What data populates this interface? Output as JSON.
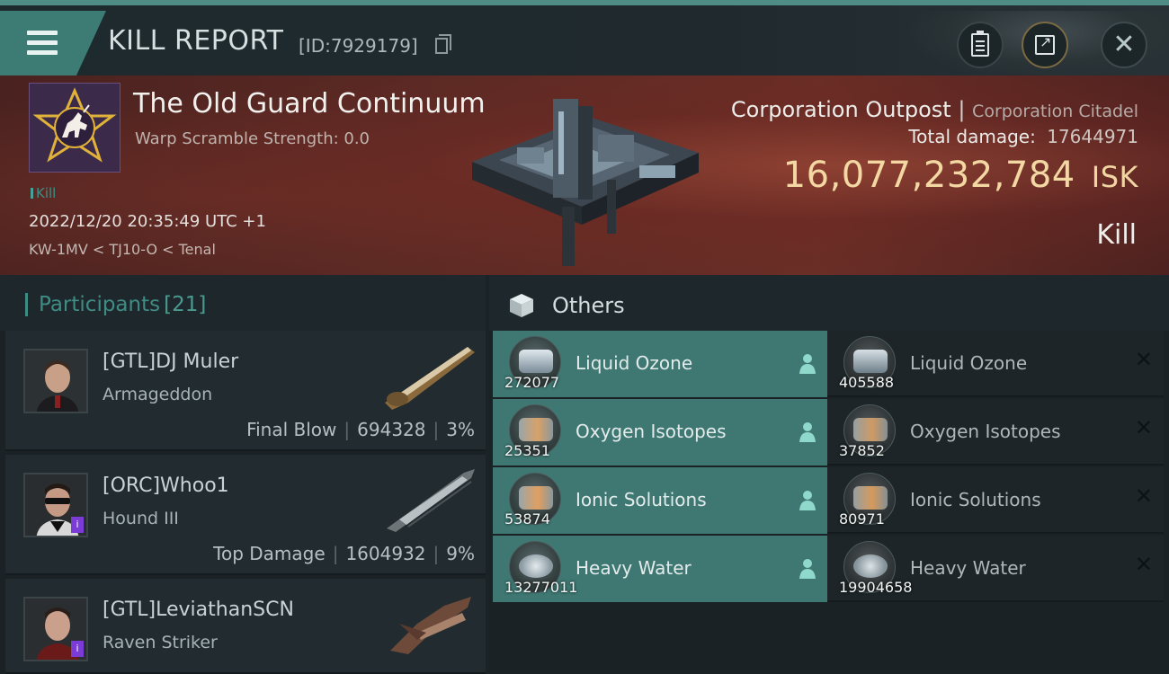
{
  "header": {
    "title": "KILL REPORT",
    "report_id": "[ID:7929179]"
  },
  "banner": {
    "corp_name": "The Old Guard Continuum",
    "warp_scramble": "Warp Scramble Strength: 0.0",
    "kill_tag": "Kill",
    "timestamp": "2022/12/20 20:35:49 UTC +1",
    "location": "KW-1MV < TJ10-O < Tenal",
    "ship_type": "Corporation Outpost",
    "ship_separator": "|",
    "ship_class": "Corporation Citadel",
    "total_damage_label": "Total damage:",
    "total_damage_value": "17644971",
    "isk_value": "16,077,232,784",
    "isk_unit": "ISK",
    "result": "Kill"
  },
  "participants": {
    "label": "Participants",
    "count": "[21]",
    "rows": [
      {
        "name": "[GTL]DJ Muler",
        "ship": "Armageddon",
        "role": "Final Blow",
        "sep1": "|",
        "damage": "694328",
        "sep2": "|",
        "percent": "3%"
      },
      {
        "name": "[ORC]Whoo1",
        "ship": "Hound III",
        "role": "Top Damage",
        "sep1": "|",
        "damage": "1604932",
        "sep2": "|",
        "percent": "9%"
      },
      {
        "name": "[GTL]LeviathanSCN",
        "ship": "Raven Striker"
      }
    ]
  },
  "others": {
    "title": "Others",
    "dropped": [
      {
        "name": "Liquid Ozone",
        "qty": "272077"
      },
      {
        "name": "Oxygen Isotopes",
        "qty": "25351"
      },
      {
        "name": "Ionic Solutions",
        "qty": "53874"
      },
      {
        "name": "Heavy Water",
        "qty": "13277011"
      }
    ],
    "destroyed": [
      {
        "name": "Liquid Ozone",
        "qty": "405588"
      },
      {
        "name": "Oxygen Isotopes",
        "qty": "37852"
      },
      {
        "name": "Ionic Solutions",
        "qty": "80971"
      },
      {
        "name": "Heavy Water",
        "qty": "19904658"
      }
    ]
  },
  "colors": {
    "accent_teal": "#3f8c84",
    "dropped_row": "#3f7873",
    "isk_gold": "#f4d8a4",
    "banner_red": "#5d2a24"
  },
  "icons": {
    "menu": "hamburger-icon",
    "copy": "copy-icon",
    "clipboard": "clipboard-icon",
    "share": "share-icon",
    "close": "close-icon",
    "others": "cube-icon",
    "dropped_marker": "person-icon",
    "destroyed_marker": "x-icon"
  }
}
